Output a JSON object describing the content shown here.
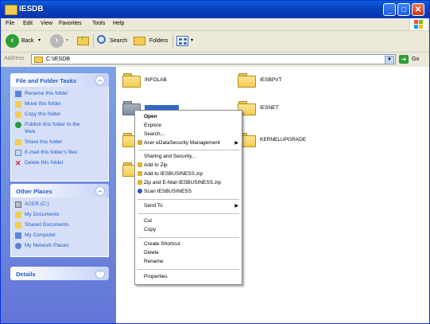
{
  "window": {
    "title": "IESDB",
    "minimize": "_",
    "maximize": "□",
    "close": "✕"
  },
  "menu": [
    "File",
    "Edit",
    "View",
    "Favorites",
    "Tools",
    "Help"
  ],
  "toolbar": {
    "back": "Back",
    "search": "Search",
    "folders": "Folders"
  },
  "address": {
    "label": "Address",
    "value": "C:\\IESDB",
    "go": "Go"
  },
  "tasks": {
    "title": "File and Folder Tasks",
    "items": [
      "Rename this folder",
      "Move this folder",
      "Copy this folder",
      "Publish this folder to the",
      "Web",
      "Share this folder",
      "E-mail this folder's files",
      "Delete this folder"
    ]
  },
  "other_places": {
    "title": "Other Places",
    "items": [
      "ACER (C:)",
      "My Documents",
      "Shared Documents",
      "My Computer",
      "My Network Places"
    ]
  },
  "details": {
    "title": "Details"
  },
  "folders": [
    "INFOLAB",
    "IESBPVT",
    "IESBUSINESS",
    "IESNET",
    "KERNELUPGRADE"
  ],
  "context_menu": {
    "open": "Open",
    "explore": "Explore",
    "search": "Search...",
    "acer": "Acer eDataSecurity Management",
    "sharing": "Sharing and Security...",
    "add_zip": "Add to Zip",
    "add_named_zip": "Add to IESBUSINESS.zip",
    "zip_email": "Zip and E-Mail IESBUSINESS.zip",
    "scan": "Scan IESBUSINESS",
    "send_to": "Send To",
    "cut": "Cut",
    "copy": "Copy",
    "create_shortcut": "Create Shortcut",
    "delete": "Delete",
    "rename": "Rename",
    "properties": "Properties"
  }
}
